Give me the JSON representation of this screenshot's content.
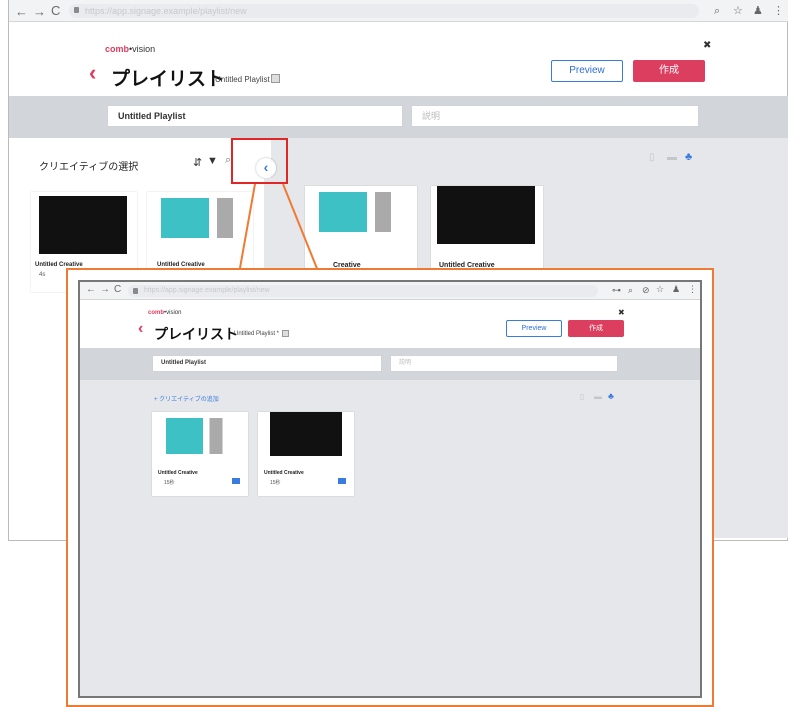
{
  "url": "https://app.signage.example/playlist/new",
  "app": {
    "logo_left": "comb",
    "logo_sep": "•",
    "logo_right": "vision"
  },
  "page": {
    "back": "‹",
    "title": "プレイリスト",
    "subtitle": "Untitled Playlist *"
  },
  "buttons": {
    "preview": "Preview",
    "create": "作成"
  },
  "close": "✖",
  "fields": {
    "name_value": "Untitled Playlist",
    "description_placeholder": "説明"
  },
  "left_panel": {
    "title": "クリエイティブの選択",
    "collapse": "‹"
  },
  "cards_back": [
    {
      "title": "Untitled Creative",
      "meta": "4s"
    },
    {
      "title": "Untitled Creative",
      "meta": ""
    },
    {
      "title": "Creative",
      "meta": ""
    },
    {
      "title": "Untitled Creative",
      "meta": ""
    }
  ],
  "inset": {
    "add_creative": "+ クリエイティブの追加",
    "cards": [
      {
        "title": "Untitled Creative",
        "meta": "15秒"
      },
      {
        "title": "Untitled Creative",
        "meta": "15秒"
      }
    ]
  },
  "colors": {
    "accent": "#dc3e5f",
    "primary": "#3a7be0",
    "highlight_red": "#e02626",
    "callout_orange": "#ef7a33"
  }
}
